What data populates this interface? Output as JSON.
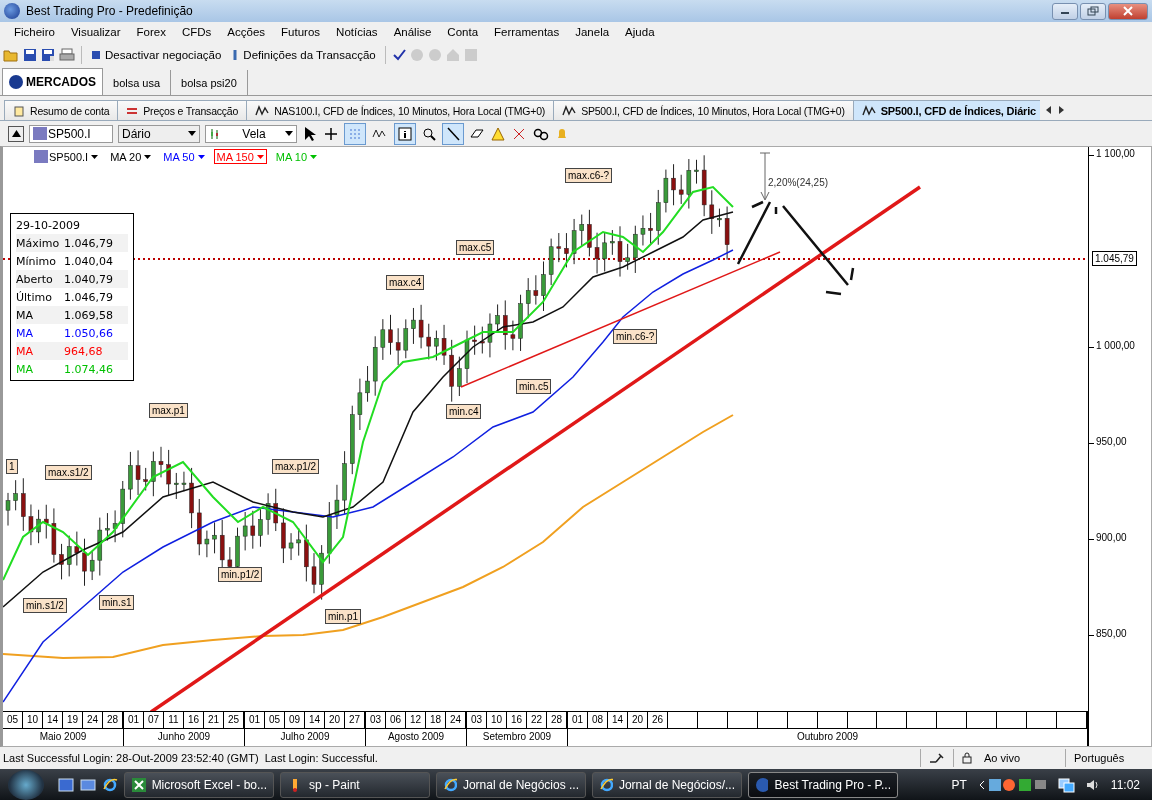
{
  "window": {
    "title": "Best Trading Pro - Predefinição"
  },
  "menu": [
    "Ficheiro",
    "Visualizar",
    "Forex",
    "CFDs",
    "Acções",
    "Futuros",
    "Notícias",
    "Análise",
    "Conta",
    "Ferramentas",
    "Janela",
    "Ajuda"
  ],
  "toolbar": {
    "buttons": [
      {
        "kind": "stop",
        "label": "Desactivar negociação"
      },
      {
        "kind": "settings",
        "label": "Definições da Transacção"
      }
    ]
  },
  "market_tabs": [
    {
      "label": "MERCADOS",
      "selected": true
    },
    {
      "label": "bolsa usa",
      "selected": false
    },
    {
      "label": "bolsa psi20",
      "selected": false
    }
  ],
  "document_tabs": [
    {
      "kind": "account",
      "label": "Resumo de conta",
      "selected": false
    },
    {
      "kind": "prices",
      "label": "Preços e Transacção",
      "selected": false
    },
    {
      "kind": "chart",
      "label": "NAS100.I, CFD de Índices, 10 Minutos, Hora Local (TMG+0)",
      "selected": false
    },
    {
      "kind": "chart",
      "label": "SP500.I, CFD de Índices, 10 Minutos, Hora Local (TMG+0)",
      "selected": false
    },
    {
      "kind": "chart",
      "label": "SP500.I, CFD de Índices, Diáric",
      "selected": true
    }
  ],
  "chart_toolbar": {
    "symbol": "SP500.I",
    "period": "Dário",
    "chart_type": "Vela"
  },
  "legend": [
    {
      "label": "SP500.I",
      "color": "#000000",
      "selected": false
    },
    {
      "label": "MA 20",
      "color": "#000000",
      "selected": false
    },
    {
      "label": "MA 50",
      "color": "#0000ff",
      "selected": false
    },
    {
      "label": "MA 150",
      "color": "#ff0000",
      "selected": true
    },
    {
      "label": "MA 10",
      "color": "#00c000",
      "selected": false
    }
  ],
  "info_box": {
    "date": "29-10-2009",
    "rows": [
      {
        "label": "Máximo",
        "value": "1.046,79"
      },
      {
        "label": "Mínimo",
        "value": "1.040,04"
      },
      {
        "label": "Aberto",
        "value": "1.040,79"
      },
      {
        "label": "Último",
        "value": "1.046,79"
      },
      {
        "label": "MA",
        "value": "1.069,58"
      },
      {
        "label": "MA",
        "value": "1.050,66",
        "color": "#0000ff"
      },
      {
        "label": "MA",
        "value": "964,68",
        "color": "#ff0000"
      },
      {
        "label": "MA",
        "value": "1.074,46",
        "color": "#00c000"
      }
    ]
  },
  "annotations": [
    "max.c6-?",
    "max.c5",
    "max.c4",
    "min.c6-?",
    "min.c5",
    "min.c4",
    "max.p1",
    "max.s1/2",
    "max.p1/2",
    "min.p1/2",
    "min.s1",
    "min.s1/2",
    "min.p1",
    "1"
  ],
  "measure_label": "2,20%(24,25)",
  "y_axis": {
    "ticks": [
      "1 100,00",
      "1 000,00",
      "950,00",
      "900,00",
      "850,00"
    ],
    "current_price": "1.045,79"
  },
  "x_axis": {
    "months": [
      {
        "label": "Maio 2009",
        "days": [
          "05",
          "10",
          "14",
          "19",
          "24",
          "28"
        ]
      },
      {
        "label": "Junho 2009",
        "days": [
          "01",
          "07",
          "11",
          "16",
          "21",
          "25"
        ]
      },
      {
        "label": "Julho 2009",
        "days": [
          "01",
          "05",
          "09",
          "14",
          "20",
          "27"
        ]
      },
      {
        "label": "Agosto 2009",
        "days": [
          "03",
          "06",
          "12",
          "18",
          "24"
        ]
      },
      {
        "label": "Setembro 2009",
        "days": [
          "03",
          "10",
          "16",
          "22",
          "28"
        ]
      },
      {
        "label": "Outubro 2009",
        "days": [
          "01",
          "08",
          "14",
          "20",
          "26"
        ]
      }
    ]
  },
  "status_bar": {
    "message": "Last Successful Login: 28-Out-2009 23:52:40 (GMT)  Last Login: Successful.",
    "connection": "Ao vivo",
    "language": "Português"
  },
  "taskbar": {
    "items": [
      {
        "kind": "excel",
        "label": "Microsoft Excel - bo...",
        "selected": false
      },
      {
        "kind": "paint",
        "label": "sp - Paint",
        "selected": false
      },
      {
        "kind": "browser",
        "label": "Jornal de Negócios ...",
        "selected": false
      },
      {
        "kind": "browser",
        "label": "Jornal de Negócios/...",
        "selected": false
      },
      {
        "kind": "app",
        "label": "Best Trading Pro - P...",
        "selected": true
      }
    ],
    "language": "PT",
    "time": "11:02"
  }
}
